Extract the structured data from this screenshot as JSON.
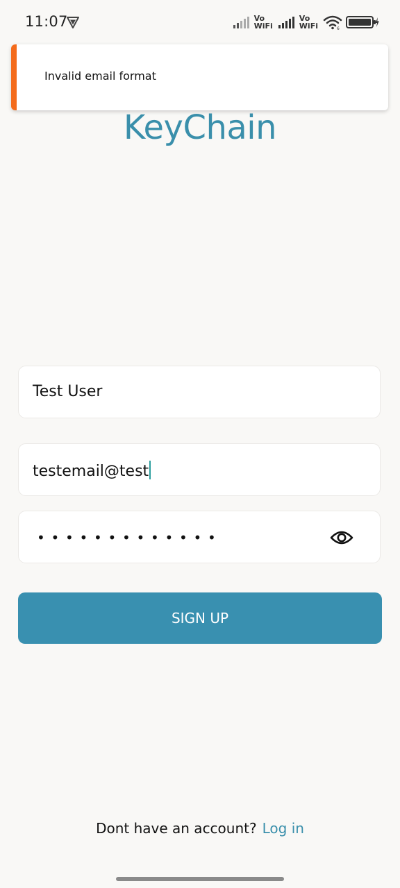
{
  "status_bar": {
    "time": "11:07",
    "vowifi_1": [
      "Vo",
      "WiFi"
    ],
    "vowifi_2": [
      "Vo",
      "WiFi"
    ],
    "battery": "100",
    "icons": [
      "vpn-icon",
      "signal-icon",
      "wifi-icon",
      "battery-icon",
      "charging-icon"
    ]
  },
  "toast": {
    "message": "Invalid email format",
    "accent_color": "#f46b1b"
  },
  "brand": {
    "title": "KeyChain",
    "color": "#3a8fab"
  },
  "form": {
    "name_value": "Test User",
    "email_value": "testemail@test",
    "password_dots": "•••••••••••••",
    "visibility_icon": "eye-icon"
  },
  "signup_button": {
    "label": "SIGN UP",
    "color": "#3990b0"
  },
  "footer": {
    "prompt": "Dont have an account?",
    "link": "Log in"
  }
}
